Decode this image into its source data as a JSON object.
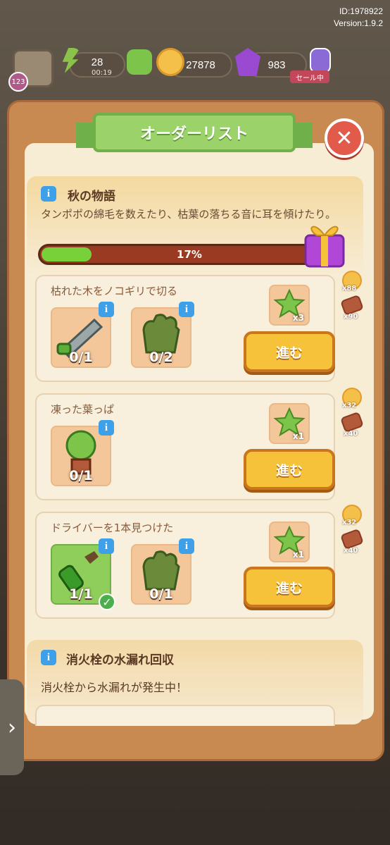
{
  "header": {
    "id_text": "ID:1978922",
    "version_text": "Version:1.9.2"
  },
  "topbar": {
    "level": "123",
    "energy": "28",
    "energy_timer": "00:19",
    "coins": "27878",
    "gems": "983",
    "sale_label": "セール中"
  },
  "dialog": {
    "title": "オーダーリスト",
    "close_icon": "close-icon"
  },
  "story": {
    "title": "秋の物語",
    "description": "タンポポの綿毛を数えたり、枯葉の落ちる音に耳を傾けたり。",
    "progress_text": "17%",
    "progress_percent": 17
  },
  "tasks": [
    {
      "name": "枯れた木をノコギリで切る",
      "items": [
        {
          "icon": "saw-icon",
          "count": "0/1",
          "done": false
        },
        {
          "icon": "glove-icon",
          "count": "0/2",
          "done": false
        }
      ],
      "reward_count": "x3",
      "button": "進む",
      "side_coin": "x88",
      "side_wood": "x90"
    },
    {
      "name": "凍った葉っぱ",
      "items": [
        {
          "icon": "potted-tree-icon",
          "count": "0/1",
          "done": false
        }
      ],
      "reward_count": "x1",
      "button": "進む",
      "side_coin": "x32",
      "side_wood": "x40"
    },
    {
      "name": "ドライバーを1本見つけた",
      "items": [
        {
          "icon": "screwdriver-icon",
          "count": "1/1",
          "done": true
        },
        {
          "icon": "glove-icon",
          "count": "0/1",
          "done": false
        }
      ],
      "reward_count": "x1",
      "button": "進む",
      "side_coin": "x32",
      "side_wood": "x40"
    }
  ],
  "story2": {
    "title": "消火栓の水漏れ回収",
    "description": "消火栓から水漏れが発生中！"
  },
  "side_tab": {
    "icon": "chevron-right-icon"
  }
}
